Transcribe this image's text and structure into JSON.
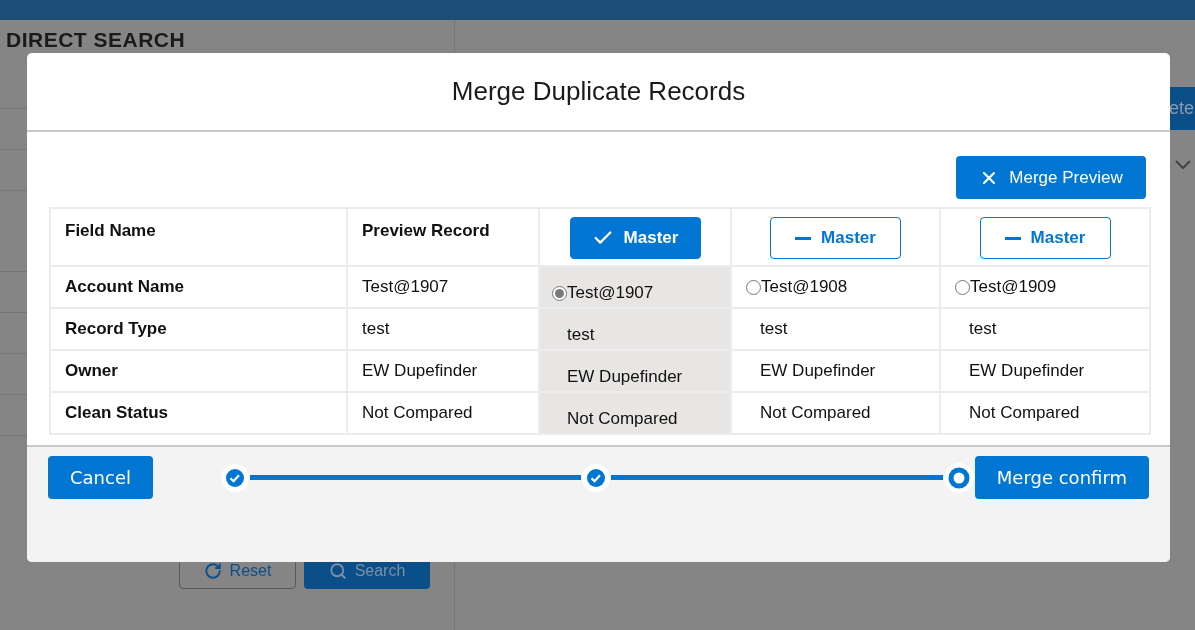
{
  "background": {
    "heading": "DIRECT SEARCH",
    "reset_button": "Reset",
    "search_button": "Search",
    "top_right_button": "ete"
  },
  "modal": {
    "title": "Merge Duplicate Records",
    "preview_button": "Merge Preview",
    "table": {
      "columns": [
        "Field Name",
        "Preview Record"
      ],
      "rows": [
        {
          "field": "Account Name",
          "preview": "Test@1907"
        },
        {
          "field": "Record Type",
          "preview": "test"
        },
        {
          "field": "Owner",
          "preview": "EW Dupefinder"
        },
        {
          "field": "Clean Status",
          "preview": "Not Compared"
        }
      ],
      "records": [
        {
          "master_label": "Master",
          "selected": true,
          "values": [
            "Test@1907",
            "test",
            "EW Dupefinder",
            "Not Compared"
          ]
        },
        {
          "master_label": "Master",
          "selected": false,
          "values": [
            "Test@1908",
            "test",
            "EW Dupefinder",
            "Not Compared"
          ]
        },
        {
          "master_label": "Master",
          "selected": false,
          "values": [
            "Test@1909",
            "test",
            "EW Dupefinder",
            "Not Compared"
          ]
        }
      ]
    },
    "footer": {
      "cancel": "Cancel",
      "steps": [
        {
          "done": true
        },
        {
          "done": true
        },
        {
          "done": false
        }
      ],
      "confirm": "Merge confirm"
    }
  }
}
